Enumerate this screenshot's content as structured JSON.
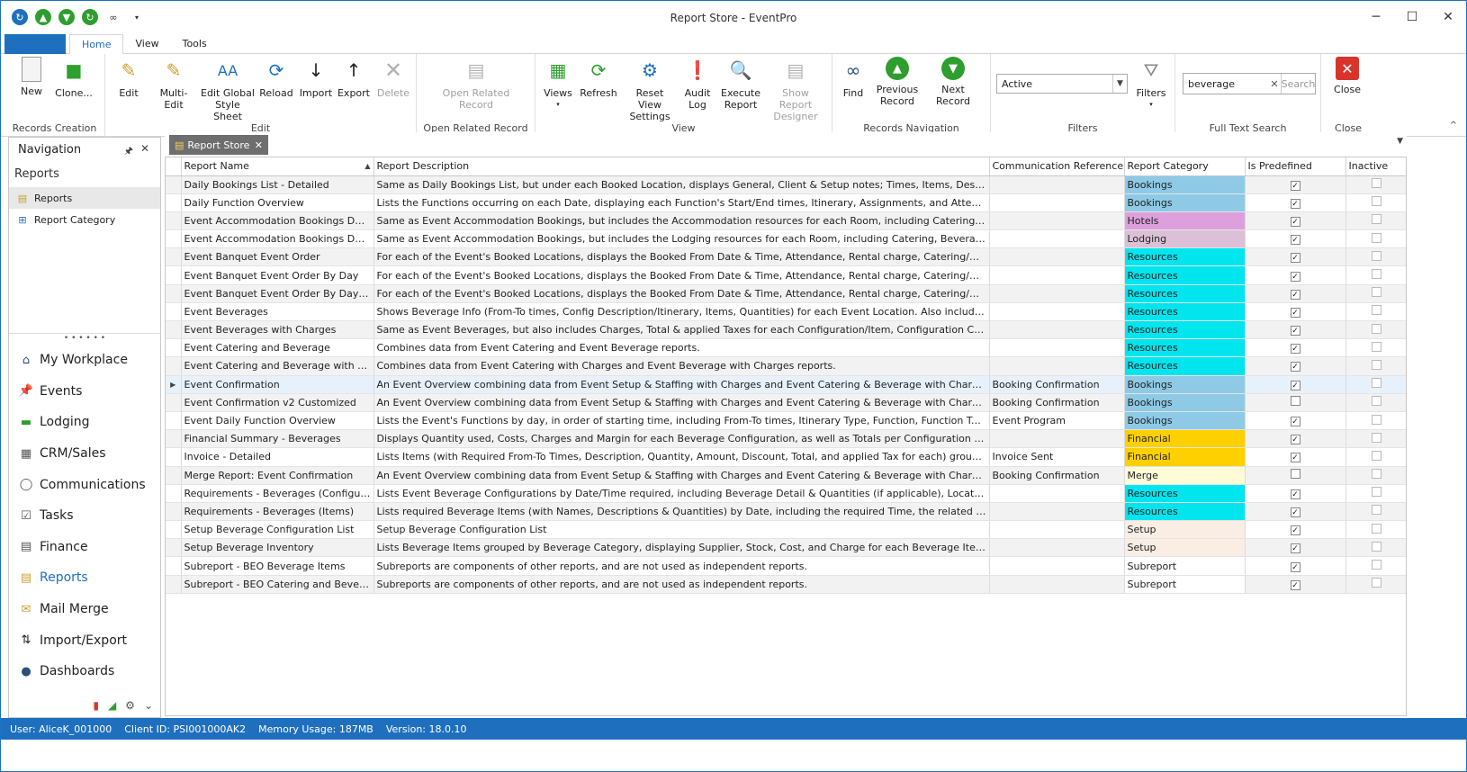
{
  "window": {
    "title": "Report Store - EventPro"
  },
  "menu": {
    "tabs": [
      "Home",
      "View",
      "Tools"
    ]
  },
  "ribbon": {
    "groups": {
      "records_creation": "Records Creation",
      "edit": "Edit",
      "open_related": "Open Related Record",
      "view": "View",
      "records_navigation": "Records Navigation",
      "filters": "Filters",
      "full_text_search": "Full Text Search",
      "close": "Close"
    },
    "buttons": {
      "new": "New",
      "clone": "Clone...",
      "edit": "Edit",
      "multi_edit": "Multi-Edit",
      "edit_global_style": "Edit Global Style Sheet",
      "reload": "Reload",
      "import": "Import",
      "export": "Export",
      "delete": "Delete",
      "open_related": "Open Related Record",
      "views": "Views",
      "refresh": "Refresh",
      "reset_view": "Reset View Settings",
      "audit_log": "Audit Log",
      "execute_report": "Execute Report",
      "show_designer": "Show Report Designer",
      "find": "Find",
      "previous_record": "Previous Record",
      "next_record": "Next Record",
      "filters": "Filters",
      "search": "Search",
      "close": "Close"
    },
    "filter_value": "Active",
    "search_value": "beverage"
  },
  "nav": {
    "title": "Navigation",
    "section": "Reports",
    "links": [
      "Reports",
      "Report Category"
    ],
    "modules": [
      "My Workplace",
      "Events",
      "Lodging",
      "CRM/Sales",
      "Communications",
      "Tasks",
      "Finance",
      "Reports",
      "Mail Merge",
      "Import/Export",
      "Dashboards"
    ]
  },
  "doc_tab": "Report Store",
  "grid": {
    "columns": [
      "Report Name",
      "Report Description",
      "Communication Reference",
      "Report Category",
      "Is Predefined",
      "Inactive"
    ],
    "rows": [
      {
        "name": "Daily Bookings List - Detailed",
        "desc": "Same as Daily Bookings List, but under each Booked Location, displays General, Client & Setup notes; Times, Items, Descriptions & numbers for ...",
        "ref": "",
        "cat": "Bookings",
        "pre": true,
        "ina": false
      },
      {
        "name": "Daily Function Overview",
        "desc": "Lists the Functions occurring on each Date, displaying each Function's Start/End times, Itinerary, Assignments, and Attendees, as well as the B...",
        "ref": "",
        "cat": "Bookings",
        "pre": true,
        "ina": false
      },
      {
        "name": "Event Accommodation Bookings Detailed (...",
        "desc": "Same as Event Accommodation Bookings, but includes the Accommodation resources for each Room, including Catering, Beverage, Staffing, Set...",
        "ref": "",
        "cat": "Hotels",
        "pre": true,
        "ina": false
      },
      {
        "name": "Event Accommodation Bookings Detailed (...",
        "desc": "Same as Event Accommodation Bookings, but includes the Lodging resources for each Room, including Catering, Beverage, Staffing, Setup & Mi...",
        "ref": "",
        "cat": "Lodging",
        "pre": true,
        "ina": false
      },
      {
        "name": "Event Banquet Event Order",
        "desc": "For each of the Event's Booked Locations, displays the Booked From Date & Time, Attendance, Rental charge, Catering/Beverage counts & req...",
        "ref": "",
        "cat": "Resources",
        "pre": true,
        "ina": false
      },
      {
        "name": "Event Banquet Event Order By Day",
        "desc": "For each of the Event's Booked Locations, displays the Booked From Date & Time, Attendance, Rental charge, Catering/Beverage counts & req...",
        "ref": "",
        "cat": "Resources",
        "pre": true,
        "ina": false
      },
      {
        "name": "Event Banquet Event Order By Day Fixed ...",
        "desc": "For each of the Event's Booked Locations, displays the Booked From Date & Time, Attendance, Rental charge, Catering/Beverage counts & req...",
        "ref": "",
        "cat": "Resources",
        "pre": true,
        "ina": false
      },
      {
        "name": "Event Beverages",
        "desc": "Shows Beverage Info (From-To times, Config Description/Itinerary, Items, Quantities) for each Event Location. Also includes Event Comments, ...",
        "ref": "",
        "cat": "Resources",
        "pre": true,
        "ina": false
      },
      {
        "name": "Event Beverages with Charges",
        "desc": "Same as Event Beverages, but also includes Charges, Total & applied Taxes for each Configuration/Item, Configuration Charge Type, and gran...",
        "ref": "",
        "cat": "Resources",
        "pre": true,
        "ina": false
      },
      {
        "name": "Event Catering and Beverage",
        "desc": "Combines data from Event Catering and Event Beverage reports.",
        "ref": "",
        "cat": "Resources",
        "pre": true,
        "ina": false
      },
      {
        "name": "Event Catering and Beverage with Charges",
        "desc": "Combines data from Event Catering with Charges and Event Beverage with Charges reports.",
        "ref": "",
        "cat": "Resources",
        "pre": true,
        "ina": false
      },
      {
        "name": "Event Confirmation",
        "desc": "An Event Overview combining data from Event Setup & Staffing with Charges and Event Catering & Beverage with Charges reports, plus addin...",
        "ref": "Booking Confirmation",
        "cat": "Bookings",
        "pre": true,
        "ina": false
      },
      {
        "name": "Event Confirmation v2 Customized",
        "desc": "An Event Overview combining data from Event Setup & Staffing with Charges and Event Catering & Beverage with Charges reports, plus addin...",
        "ref": "Booking Confirmation",
        "cat": "Bookings",
        "pre": false,
        "ina": false
      },
      {
        "name": "Event Daily Function Overview",
        "desc": "Lists the Event's Functions by day, in order of starting time, including From-To times, Itinerary Type, Function, Function Type, Description, Ven...",
        "ref": "Event Program",
        "cat": "Bookings",
        "pre": true,
        "ina": false
      },
      {
        "name": "Financial Summary - Beverages",
        "desc": "Displays Quantity used, Costs, Charges and Margin for each Beverage Configuration, as well as Totals per Configuration Group & Grand Total, ...",
        "ref": "",
        "cat": "Financial",
        "pre": true,
        "ina": false
      },
      {
        "name": "Invoice - Detailed",
        "desc": "Lists Items (with Required From-To Times, Description, Quantity, Amount, Discount, Total, and applied Tax for each) grouped by Financial Subg...",
        "ref": "Invoice Sent",
        "cat": "Financial",
        "pre": true,
        "ina": false
      },
      {
        "name": "Merge Report: Event Confirmation",
        "desc": "An Event Overview combining data from Event Setup & Staffing with Charges and Event Catering & Beverage with Charges reports, plus addin...",
        "ref": "Booking Confirmation",
        "cat": "Merge",
        "pre": false,
        "ina": false
      },
      {
        "name": "Requirements - Beverages (Configurations)",
        "desc": "Lists Event Beverage Configurations by Date/Time required, including Beverage Detail & Quantities (if applicable), Location, Event Name, Book ...",
        "ref": "",
        "cat": "Resources",
        "pre": true,
        "ina": false
      },
      {
        "name": "Requirements - Beverages (Items)",
        "desc": "Lists required Beverage Items (with Names, Descriptions & Quantities) by Date, including the required Time, the related Configuration, Location,...",
        "ref": "",
        "cat": "Resources",
        "pre": true,
        "ina": false
      },
      {
        "name": "Setup Beverage Configuration List",
        "desc": "Setup Beverage Configuration List",
        "ref": "",
        "cat": "Setup",
        "pre": true,
        "ina": false
      },
      {
        "name": "Setup Beverage Inventory",
        "desc": "Lists Beverage Items grouped by Beverage Category, displaying Supplier, Stock, Cost, and Charge for each Beverage Item Code.",
        "ref": "",
        "cat": "Setup",
        "pre": true,
        "ina": false
      },
      {
        "name": "Subreport - BEO Beverage Items",
        "desc": "Subreports are components of other reports, and are not used as independent reports.",
        "ref": "",
        "cat": "Subreport",
        "pre": true,
        "ina": false
      },
      {
        "name": "Subreport - BEO Catering and Beverage I...",
        "desc": "Subreports are components of other reports, and are not used as independent reports.",
        "ref": "",
        "cat": "Subreport",
        "pre": true,
        "ina": false
      }
    ],
    "count": "23",
    "category_colors": {
      "Bookings": "#8ecae6",
      "Hotels": "#dda0dd",
      "Lodging": "#dcc0d8",
      "Resources": "#00e5ee",
      "Financial": "#ffd000",
      "Merge": "#fffbd6",
      "Setup": "#faeee4",
      "Subreport": "#ffffff"
    }
  },
  "status": {
    "user": "User: AliceK_001000",
    "client": "Client ID: PSI001000AK2",
    "memory": "Memory Usage: 187MB",
    "version": "Version: 18.0.10"
  }
}
